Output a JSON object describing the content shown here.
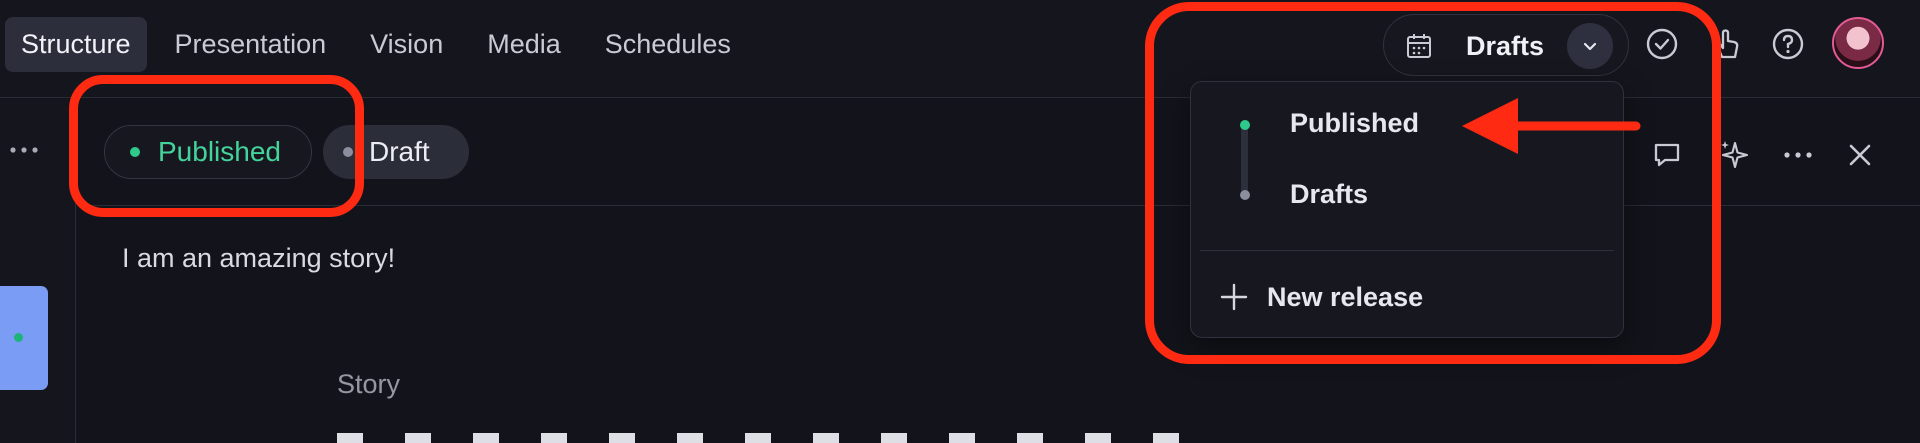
{
  "nav": {
    "tabs": [
      {
        "label": "Structure",
        "active": true
      },
      {
        "label": "Presentation",
        "active": false
      },
      {
        "label": "Vision",
        "active": false
      },
      {
        "label": "Media",
        "active": false
      },
      {
        "label": "Schedules",
        "active": false
      }
    ],
    "release_selector": {
      "label": "Drafts",
      "icon": "calendar-icon",
      "toggle_icon": "chevron-down-icon"
    },
    "icons": [
      "check-circle-icon",
      "pointer-hand-icon",
      "help-icon"
    ],
    "avatar": "user-avatar"
  },
  "editor": {
    "status_chips": [
      {
        "label": "Published",
        "dot_color": "#2ec98b",
        "text_color": "#43d39b"
      },
      {
        "label": "Draft",
        "dot_color": "#8b8e9c",
        "text_color": "#eceef4"
      }
    ],
    "toolbar_icons": [
      "comment-icon",
      "sparkles-icon",
      "more-icon",
      "close-icon"
    ],
    "intro_text": "I am an amazing story!",
    "field_label": "Story"
  },
  "dropdown": {
    "items": [
      {
        "label": "Published",
        "dot_color": "#2ec98b"
      },
      {
        "label": "Drafts",
        "dot_color": "#8b8e9c"
      }
    ],
    "new_release": {
      "label": "New release",
      "icon": "plus-icon"
    }
  },
  "annotations": {
    "color": "#ff2a12"
  }
}
